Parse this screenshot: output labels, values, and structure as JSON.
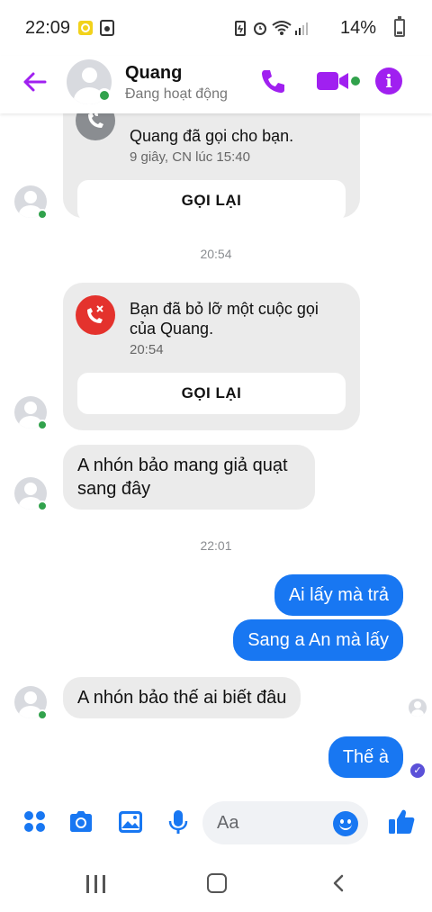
{
  "status_bar": {
    "time": "22:09",
    "battery": "14%",
    "icons": [
      "notification-app-icon",
      "screenshot-icon",
      "battery-saver-icon",
      "alarm-icon",
      "wifi-icon",
      "signal-icon"
    ]
  },
  "header": {
    "contact_name": "Quang",
    "status": "Đang hoạt động",
    "accent_color": "#a020f0",
    "icons": [
      "back-arrow-icon",
      "phone-icon",
      "video-call-icon",
      "info-icon"
    ]
  },
  "conversation": {
    "call_card_1": {
      "text": "Quang đã gọi cho bạn.",
      "sub": "9 giây, CN lúc 15:40",
      "button": "GỌI LẠI"
    },
    "timestamp_1": "20:54",
    "call_card_2": {
      "text": "Bạn đã bỏ lỡ một cuộc gọi của Quang.",
      "sub": "20:54",
      "button": "GỌI LẠI"
    },
    "incoming_1": "A nhón bảo mang giả quạt sang đây",
    "timestamp_2": "22:01",
    "outgoing_1": "Ai lấy mà trả",
    "outgoing_2": "Sang a An mà lấy",
    "incoming_2": "A nhón bảo thế ai biết đâu",
    "outgoing_3": "Thế à",
    "outgoing_color": "#1877f2"
  },
  "composer": {
    "placeholder": "Aa",
    "icons": [
      "menu-grid-icon",
      "camera-icon",
      "gallery-icon",
      "microphone-icon",
      "emoji-icon",
      "like-icon"
    ]
  },
  "nav_bar": {
    "icons": [
      "recent-apps-icon",
      "home-icon",
      "back-icon"
    ]
  }
}
